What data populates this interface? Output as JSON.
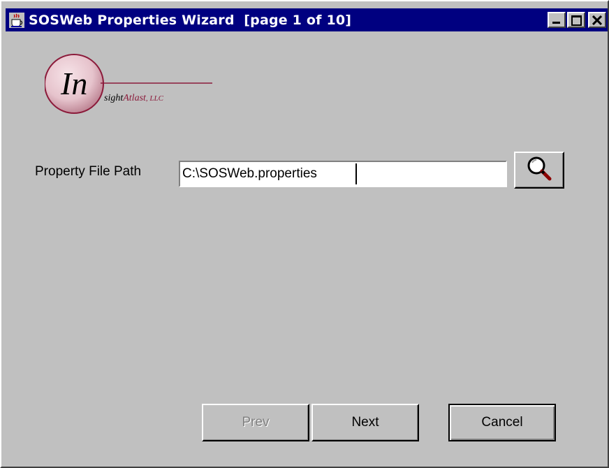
{
  "window": {
    "title": "SOSWeb Properties Wizard  [page 1 of 10]",
    "icons": {
      "app": "java-coffee-cup-icon",
      "minimize": "minimize-icon",
      "maximize": "maximize-icon",
      "close": "close-icon"
    }
  },
  "logo": {
    "letters": "In",
    "text_italic": "sight",
    "text_brand": "Atlast",
    "text_suffix": ", LLC",
    "brand_color": "#8b1a3a"
  },
  "form": {
    "property_label": "Property File Path",
    "property_value": "C:\\SOSWeb.properties",
    "browse_icon": "magnifying-glass-icon"
  },
  "buttons": {
    "prev": "Prev",
    "next": "Next",
    "cancel": "Cancel"
  }
}
